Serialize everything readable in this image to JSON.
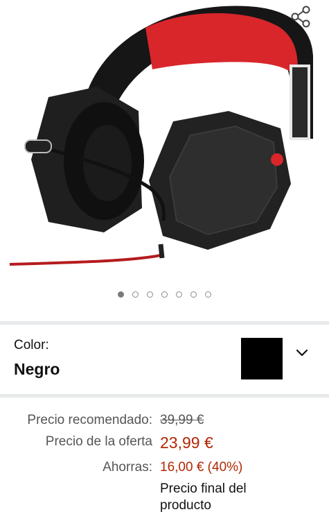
{
  "gallery": {
    "image_alt": "Auriculares gaming con micrófono, negros y rojos",
    "dots_total": 7,
    "active_dot": 0,
    "share_icon": "share-icon"
  },
  "color": {
    "label": "Color:",
    "value": "Negro",
    "swatch_color": "#000000"
  },
  "price": {
    "list_label": "Precio recomendado:",
    "list_value": "39,99 €",
    "deal_label": "Precio de la oferta",
    "deal_value": "23,99 €",
    "savings_label": "Ahorras:",
    "savings_value": "16,00 € (40%)",
    "final_note": "Precio final del producto"
  },
  "colors": {
    "price_red": "#b12704",
    "divider": "#e7e9ea",
    "headset_red": "#d8262b"
  }
}
